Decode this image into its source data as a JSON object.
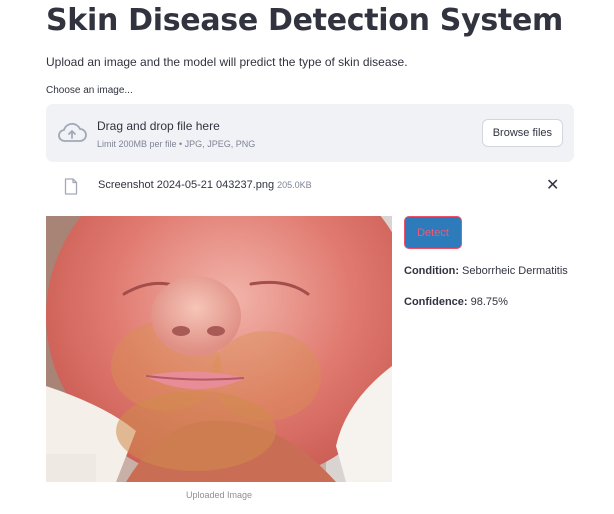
{
  "header": {
    "title": "Skin Disease Detection System",
    "subtitle": "Upload an image and the model will predict the type of skin disease."
  },
  "uploader": {
    "label": "Choose an image...",
    "dropzone_title": "Drag and drop file here",
    "dropzone_subtitle": "Limit 200MB per file • JPG, JPEG, PNG",
    "browse_label": "Browse files",
    "upload_icon": "cloud-upload-icon"
  },
  "uploaded_file": {
    "name": "Screenshot 2024-05-21 043237.png",
    "size": "205.0KB",
    "file_icon": "file-icon",
    "remove_symbol": "✕"
  },
  "image": {
    "caption": "Uploaded Image"
  },
  "actions": {
    "detect_label": "Detect"
  },
  "result": {
    "condition_label": "Condition:",
    "condition_value": "Seborrheic Dermatitis",
    "confidence_label": "Confidence:",
    "confidence_value": "98.75%"
  },
  "colors": {
    "detect_bg": "#2e7bbb",
    "detect_border": "#ef4f67",
    "dropzone_bg": "#f0f2f6",
    "text": "#31333f"
  }
}
